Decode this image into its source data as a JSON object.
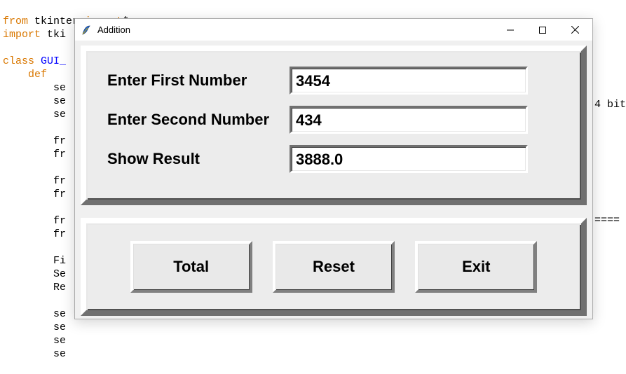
{
  "editor": {
    "line1": {
      "a": "from",
      "b": " tkinter ",
      "c": "import",
      "d": "*"
    },
    "line2": {
      "a": "import",
      "b": " tki"
    },
    "line4": {
      "a": "class",
      "b": " GUI_"
    },
    "line5": {
      "a": "    ",
      "b": "def",
      "c": " "
    },
    "line6": "        se",
    "line7": "        se",
    "line8": "        se",
    "line10": "        fr",
    "line11": "        fr",
    "line13": "        fr",
    "line14": "        fr",
    "line16": "        fr",
    "line17": "        fr",
    "line19": "        Fi",
    "line20": "        Se",
    "line21": "        Re",
    "line23": "        se",
    "line24": "        se",
    "line25": "        se",
    "line26": "        se",
    "right1": "4 bit",
    "right2": "===="
  },
  "window": {
    "title": "Addition",
    "labels": {
      "first": "Enter First Number",
      "second": "Enter Second Number",
      "result": "Show Result"
    },
    "values": {
      "first": "3454",
      "second": "434",
      "result": "3888.0"
    },
    "buttons": {
      "total": "Total",
      "reset": "Reset",
      "exit": "Exit"
    }
  }
}
